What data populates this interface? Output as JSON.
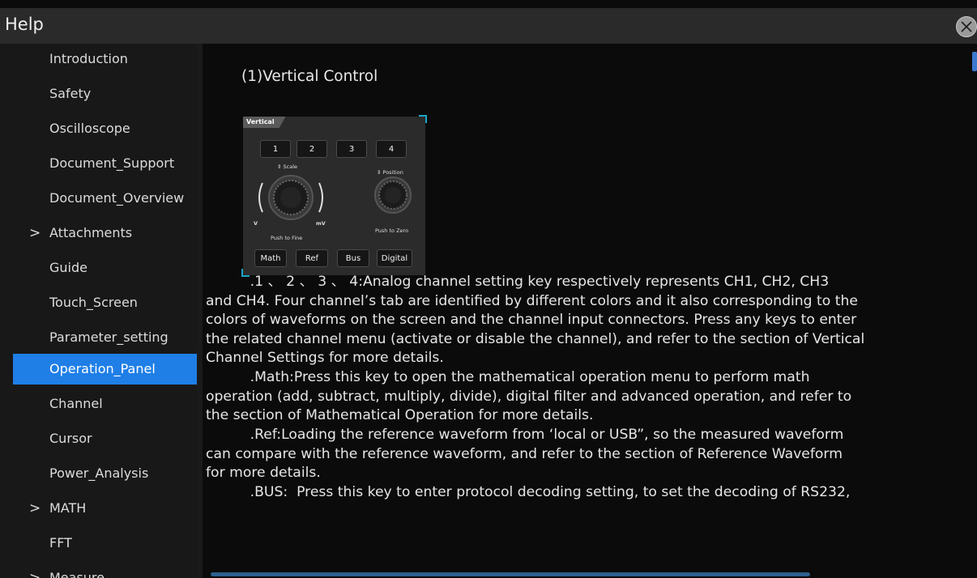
{
  "window": {
    "title": "Help"
  },
  "sidebar": {
    "items": [
      {
        "label": "Introduction",
        "expandable": false,
        "selected": false
      },
      {
        "label": "Safety",
        "expandable": false,
        "selected": false
      },
      {
        "label": "Oscilloscope",
        "expandable": false,
        "selected": false
      },
      {
        "label": "Document_Support",
        "expandable": false,
        "selected": false
      },
      {
        "label": "Document_Overview",
        "expandable": false,
        "selected": false
      },
      {
        "label": "Attachments",
        "expandable": true,
        "selected": false
      },
      {
        "label": "Guide",
        "expandable": false,
        "selected": false
      },
      {
        "label": "Touch_Screen",
        "expandable": false,
        "selected": false
      },
      {
        "label": "Parameter_setting",
        "expandable": false,
        "selected": false
      },
      {
        "label": "Operation_Panel",
        "expandable": false,
        "selected": true
      },
      {
        "label": "Channel",
        "expandable": false,
        "selected": false
      },
      {
        "label": "Cursor",
        "expandable": false,
        "selected": false
      },
      {
        "label": "Power_Analysis",
        "expandable": false,
        "selected": false
      },
      {
        "label": "MATH",
        "expandable": true,
        "selected": false
      },
      {
        "label": "FFT",
        "expandable": false,
        "selected": false
      },
      {
        "label": "Measure",
        "expandable": true,
        "selected": false
      }
    ],
    "chevron": ">"
  },
  "content": {
    "section_title": "(1)Vertical Control",
    "panel_image": {
      "tab": "Vertical",
      "channel_keys": [
        "1",
        "2",
        "3",
        "4"
      ],
      "scale_label": "⇕ Scale",
      "position_label": "⇕ Position",
      "v_label": "V",
      "mv_label": "mV",
      "push_fine": "Push to Fine",
      "push_zero": "Push to Zero",
      "bottom_keys": [
        "Math",
        "Ref",
        "Bus",
        "Digital"
      ]
    },
    "paragraphs": [
      "          .1 、 2 、 3 、 4:Analog channel setting key respectively represents CH1, CH2, CH3\nand CH4. Four channel’s tab are identified by different colors and it also corresponding to the\ncolors of waveforms on the screen and the channel input connectors. Press any keys to enter\nthe related channel menu (activate or disable the channel), and refer to the section of Vertical\nChannel Settings for more details.",
      "          .Math:Press this key to open the mathematical operation menu to perform math\noperation (add, subtract, multiply, divide), digital filter and advanced operation, and refer to\nthe section of Mathematical Operation for more details.",
      "          .Ref:Loading the reference waveform from ‘local or USB”, so the measured waveform\ncan compare with the reference waveform, and refer to the section of Reference Waveform\nfor more details.",
      "          .BUS:  Press this key to enter protocol decoding setting, to set the decoding of RS232,"
    ]
  },
  "colors": {
    "selected": "#1f7fe6",
    "titlebar": "#2a2a2a",
    "sidebar": "#181818",
    "background": "#0b0b0b"
  },
  "icons": {
    "close": "close-icon",
    "expand": "chevron-right-icon"
  }
}
